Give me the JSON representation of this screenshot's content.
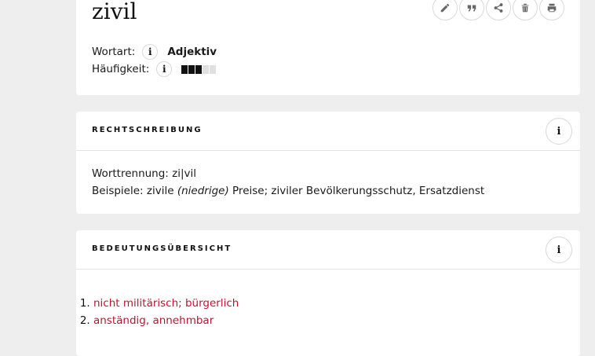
{
  "entry": {
    "headword": "zivil",
    "toolbar": [
      {
        "name": "edit-icon"
      },
      {
        "name": "quote-icon"
      },
      {
        "name": "share-icon"
      },
      {
        "name": "trash-icon"
      },
      {
        "name": "print-icon"
      }
    ],
    "wortart_label": "Wortart:",
    "wortart_value": "Adjektiv",
    "haeufigkeit_label": "Häufigkeit:",
    "haeufigkeit_level": 3,
    "haeufigkeit_max": 5,
    "info_glyph": "i"
  },
  "rechtschreibung": {
    "title": "RECHTSCHREIBUNG",
    "worttrennung_label": "Worttrennung:",
    "worttrennung_value": "zi|vil",
    "beispiele_label": "Beispiele:",
    "beispiele_pre": "zivile",
    "beispiele_italic": "(niedrige)",
    "beispiele_post": "Preise; ziviler Bevölkerungsschutz, Ersatzdienst"
  },
  "bedeutungen": {
    "title": "BEDEUTUNGSÜBERSICHT",
    "items": [
      "nicht militärisch; bürgerlich",
      "anständig, annehmbar"
    ]
  },
  "colors": {
    "accent": "#c4112f",
    "background": "#eeeeee"
  }
}
